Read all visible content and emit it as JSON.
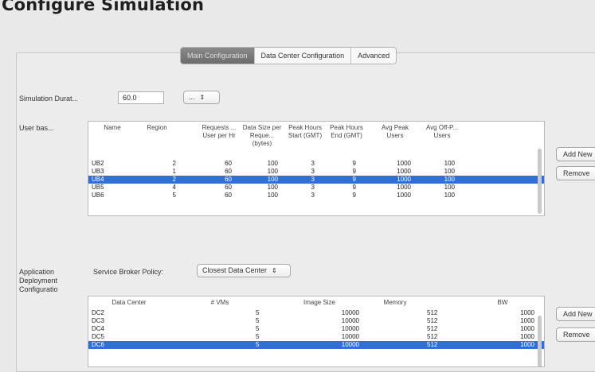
{
  "page_title": "Configure Simulation",
  "tabs": [
    {
      "label": "Main Configuration",
      "active": true
    },
    {
      "label": "Data Center Configuration",
      "active": false
    },
    {
      "label": "Advanced",
      "active": false
    }
  ],
  "sim_duration": {
    "label": "Simulation Durat...",
    "value": "60.0",
    "unit_select": "..."
  },
  "user_bases": {
    "label": "User bas...",
    "headers": [
      "Name",
      "Region",
      "Requests ... User per Hr",
      "Data Size per Reque... (bytes)",
      "Peak Hours Start (GMT)",
      "Peak Hours End (GMT)",
      "Avg Peak Users",
      "Avg Off-P... Users"
    ],
    "rows": [
      {
        "cells": [
          "UB2",
          "2",
          "60",
          "100",
          "3",
          "9",
          "1000",
          "100"
        ],
        "selected": false
      },
      {
        "cells": [
          "UB3",
          "1",
          "60",
          "100",
          "3",
          "9",
          "1000",
          "100"
        ],
        "selected": false
      },
      {
        "cells": [
          "UB4",
          "2",
          "60",
          "100",
          "3",
          "9",
          "1000",
          "100"
        ],
        "selected": true
      },
      {
        "cells": [
          "UB5",
          "4",
          "60",
          "100",
          "3",
          "9",
          "1000",
          "100"
        ],
        "selected": false
      },
      {
        "cells": [
          "UB6",
          "5",
          "60",
          "100",
          "3",
          "9",
          "1000",
          "100"
        ],
        "selected": false
      }
    ],
    "add_label": "Add New",
    "remove_label": "Remove"
  },
  "app_deploy": {
    "label_lines": [
      "Application",
      "Deployment",
      "Configuratio"
    ],
    "broker_label": "Service Broker Policy:",
    "broker_value": "Closest Data Center",
    "headers": [
      "Data Center",
      "# VMs",
      "Image Size",
      "Memory",
      "BW"
    ],
    "rows": [
      {
        "cells": [
          "DC2",
          "5",
          "10000",
          "512",
          "1000"
        ],
        "selected": false
      },
      {
        "cells": [
          "DC3",
          "5",
          "10000",
          "512",
          "1000"
        ],
        "selected": false
      },
      {
        "cells": [
          "DC4",
          "5",
          "10000",
          "512",
          "1000"
        ],
        "selected": false
      },
      {
        "cells": [
          "DC5",
          "5",
          "10000",
          "512",
          "1000"
        ],
        "selected": false
      },
      {
        "cells": [
          "DC6",
          "5",
          "10000",
          "512",
          "1000"
        ],
        "selected": true
      }
    ],
    "add_label": "Add New",
    "remove_label": "Remove"
  },
  "colors": {
    "selection": "#2f6fd6",
    "active_tab": "#7a7a7a"
  }
}
